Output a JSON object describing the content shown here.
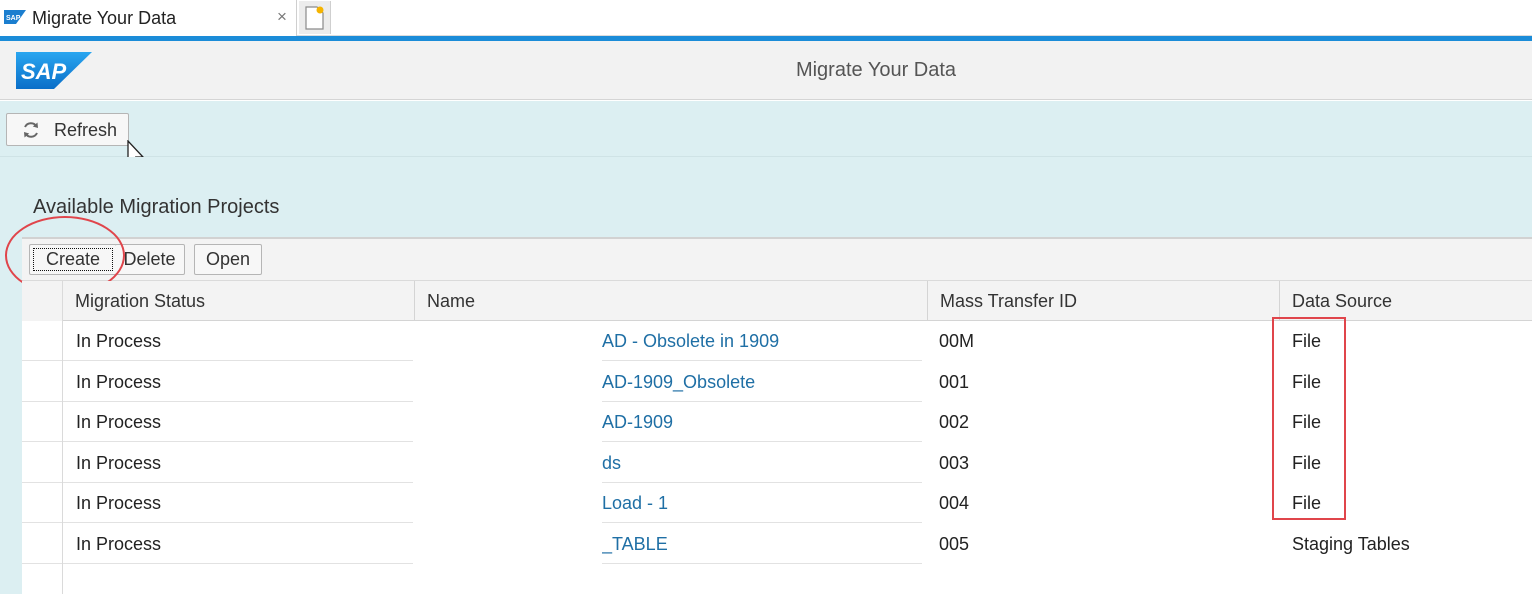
{
  "browser": {
    "tab_title": "Migrate Your Data",
    "close_glyph": "×",
    "favicon": "sap-favicon",
    "new_tab_icon": "new-tab-icon"
  },
  "shell": {
    "logo_text": "SAP",
    "app_title": "Migrate Your Data"
  },
  "toolbar": {
    "refresh_label": "Refresh",
    "refresh_icon": "refresh-icon"
  },
  "panel": {
    "title": "Available Migration Projects",
    "buttons": {
      "create": "Create",
      "delete": "Delete",
      "open": "Open"
    }
  },
  "table": {
    "columns": [
      "Migration Status",
      "Name",
      "Mass Transfer ID",
      "Data Source"
    ],
    "rows": [
      {
        "status": "In Process",
        "name": "AD - Obsolete in 1909",
        "mt_id": "00M",
        "source": "File"
      },
      {
        "status": "In Process",
        "name": "AD-1909_Obsolete",
        "mt_id": "001",
        "source": "File"
      },
      {
        "status": "In Process",
        "name": "AD-1909",
        "mt_id": "002",
        "source": "File"
      },
      {
        "status": "In Process",
        "name": "ds",
        "mt_id": "003",
        "source": "File"
      },
      {
        "status": "In Process",
        "name": " Load - 1",
        "mt_id": "004",
        "source": "File"
      },
      {
        "status": "In Process",
        "name": "_TABLE",
        "mt_id": "005",
        "source": "Staging Tables"
      }
    ]
  },
  "colors": {
    "accent_bar": "#1b8cd8",
    "band": "#dceff2",
    "link": "#1f6fa5",
    "annotation": "#e0454b"
  }
}
